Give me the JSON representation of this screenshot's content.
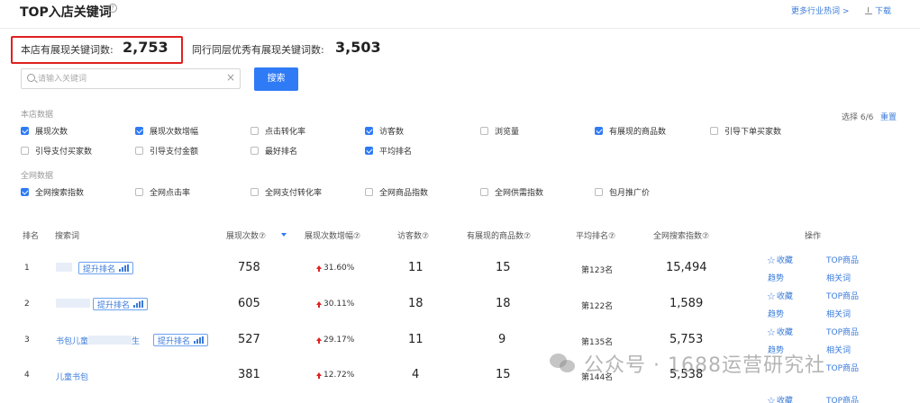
{
  "header": {
    "title": "TOP入店关键词",
    "help_icon": "?",
    "more_link": "更多行业热词 >",
    "download_label": "下载"
  },
  "summary": {
    "shop_label": "本店有展现关键词数:",
    "shop_value": "2,753",
    "peer_label": "同行同层优秀有展现关键词数:",
    "peer_value": "3,503",
    "highlight_color": "#e02020"
  },
  "search": {
    "placeholder": "请输入关键词",
    "value": "",
    "clear_glyph": "×",
    "button_label": "搜索"
  },
  "filters": {
    "shop_section_label": "本店数据",
    "network_section_label": "全网数据",
    "select_count": "选择 6/6",
    "reset_label": "重置",
    "shop_items": [
      {
        "label": "展现次数",
        "checked": true
      },
      {
        "label": "展现次数增幅",
        "checked": true
      },
      {
        "label": "点击转化率",
        "checked": false
      },
      {
        "label": "访客数",
        "checked": true
      },
      {
        "label": "浏览量",
        "checked": false
      },
      {
        "label": "有展现的商品数",
        "checked": true
      },
      {
        "label": "引导下单买家数",
        "checked": false
      },
      {
        "label": "引导支付买家数",
        "checked": false
      },
      {
        "label": "引导支付金额",
        "checked": false
      },
      {
        "label": "最好排名",
        "checked": false
      },
      {
        "label": "平均排名",
        "checked": true
      }
    ],
    "network_items": [
      {
        "label": "全网搜索指数",
        "checked": true
      },
      {
        "label": "全网点击率",
        "checked": false
      },
      {
        "label": "全网支付转化率",
        "checked": false
      },
      {
        "label": "全网商品指数",
        "checked": false
      },
      {
        "label": "全网供需指数",
        "checked": false
      },
      {
        "label": "包月推广价",
        "checked": false
      }
    ]
  },
  "table": {
    "headers": {
      "rank": "排名",
      "keyword": "搜索词",
      "impressions": "展现次数⑦",
      "growth": "展现次数增幅⑦",
      "visitors": "访客数⑦",
      "products": "有展现的商品数⑦",
      "avg_rank": "平均排名⑦",
      "search_index": "全网搜索指数⑦",
      "actions": "操作"
    },
    "boost_label": "提升排名",
    "rows": [
      {
        "rank": "1",
        "keyword": "",
        "impressions": "758",
        "growth": "31.60%",
        "visitors": "11",
        "products": "15",
        "avg_rank": "第123名",
        "search_index": "15,494"
      },
      {
        "rank": "2",
        "keyword": "",
        "impressions": "605",
        "growth": "30.11%",
        "visitors": "18",
        "products": "18",
        "avg_rank": "第122名",
        "search_index": "1,589"
      },
      {
        "rank": "3",
        "keyword": "书包儿童",
        "keyword_suffix": "生",
        "impressions": "527",
        "growth": "29.17%",
        "visitors": "11",
        "products": "9",
        "avg_rank": "第135名",
        "search_index": "5,753"
      },
      {
        "rank": "4",
        "keyword": "儿童书包",
        "impressions": "381",
        "growth": "12.72%",
        "visitors": "4",
        "products": "15",
        "avg_rank": "第144名",
        "search_index": "5,538"
      }
    ],
    "actions": {
      "favorite": "收藏",
      "top_products": "TOP商品",
      "trend": "趋势",
      "related": "相关词"
    }
  },
  "watermark": {
    "text": "公众号 · 1688运营研究社"
  },
  "colors": {
    "accent": "#2f7bf5",
    "link": "#3b7bd9",
    "up_arrow": "#e02020"
  }
}
